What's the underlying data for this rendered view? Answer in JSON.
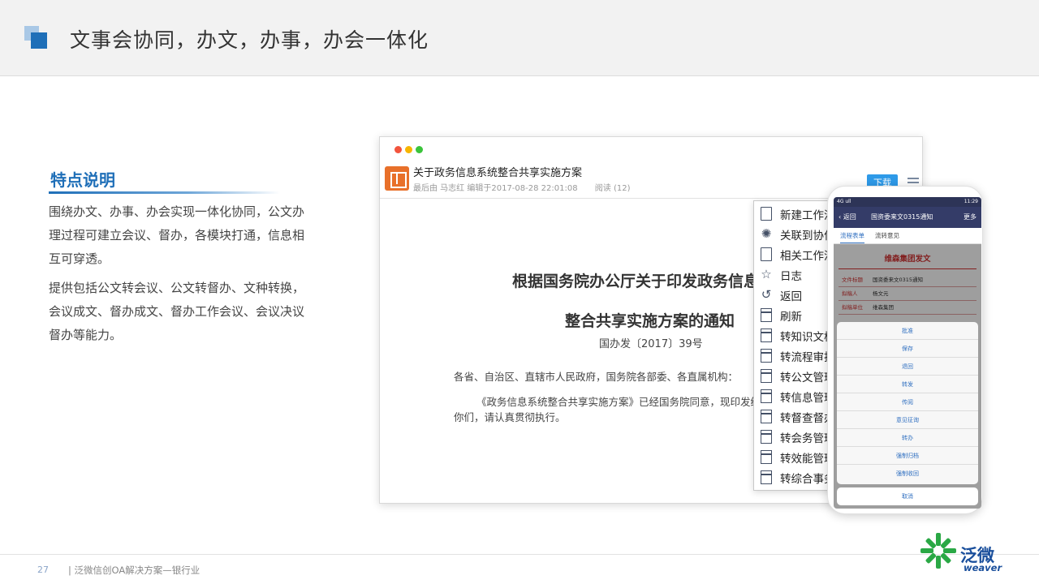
{
  "header": {
    "title": "文事会协同，办文，办事，办会一体化"
  },
  "feature": {
    "title": "特点说明",
    "paragraph1": "围绕办文、办事、办会实现一体化协同，公文办理过程可建立会议、督办，各模块打通，信息相互可穿透。",
    "paragraph2": "提供包括公文转会议、公文转督办、文种转换，会议成文、督办成文、督办工作会议、会议决议督办等能力。"
  },
  "browser": {
    "doc_title": "关于政务信息系统整合共享实施方案",
    "meta_editor": "最后由 马志红 编辑于2017-08-28 22:01:08",
    "meta_reads": "阅读 (12)",
    "download_label": "下载",
    "notice_title_line1": "根据国务院办公厅关于印发政务信息",
    "notice_title_line2": "整合共享实施方案的通知",
    "notice_number": "国办发〔2017〕39号",
    "notice_recipients": "各省、自治区、直辖市人民政府，国务院各部委、各直属机构：",
    "notice_body": "《政务信息系统整合共享实施方案》已经国务院同意，现印发给你们，请认真贯彻执行。",
    "menu_items": [
      {
        "label": "新建工作流",
        "icon": "document-icon"
      },
      {
        "label": "关联到协作",
        "icon": "gear-icon"
      },
      {
        "label": "相关工作流",
        "icon": "related-flow-icon"
      },
      {
        "label": "日志",
        "icon": "star-icon"
      },
      {
        "label": "返回",
        "icon": "undo-icon"
      },
      {
        "label": "刷新",
        "icon": "window-icon"
      },
      {
        "label": "转知识文档",
        "icon": "window-icon"
      },
      {
        "label": "转流程审批",
        "icon": "window-icon"
      },
      {
        "label": "转公文管理",
        "icon": "window-icon"
      },
      {
        "label": "转信息管理",
        "icon": "window-icon"
      },
      {
        "label": "转督查督办",
        "icon": "window-icon"
      },
      {
        "label": "转会务管理",
        "icon": "window-icon"
      },
      {
        "label": "转效能管理",
        "icon": "window-icon"
      },
      {
        "label": "转综合事务",
        "icon": "window-icon"
      }
    ]
  },
  "phone": {
    "status_left": "4G ull",
    "status_right": "11:29",
    "back_label": "返回",
    "nav_title": "国资委来文0315通知",
    "more_label": "更多",
    "tab_form": "流程表单",
    "tab_comments": "流转意见",
    "group_title": "维森集团发文",
    "rows": [
      {
        "key": "文件标题",
        "value": "国资委来文0315通知"
      },
      {
        "key": "拟稿人",
        "value": "杨文元"
      },
      {
        "key": "拟稿单位",
        "value": "维森集团"
      }
    ],
    "actions": [
      "批准",
      "保存",
      "退回",
      "转发",
      "传阅",
      "意见征询",
      "转办",
      "强制归档",
      "强制收回"
    ],
    "cancel_label": "取消"
  },
  "footer": {
    "page_number": "27",
    "text": "| 泛微信创OA解决方案—银行业",
    "logo_cn": "泛微",
    "logo_en": "weaver"
  },
  "colors": {
    "brand_blue": "#1f6fb8",
    "logo_green": "#2aa845",
    "accent_red": "#d23232",
    "download_blue": "#2e9ae8"
  }
}
